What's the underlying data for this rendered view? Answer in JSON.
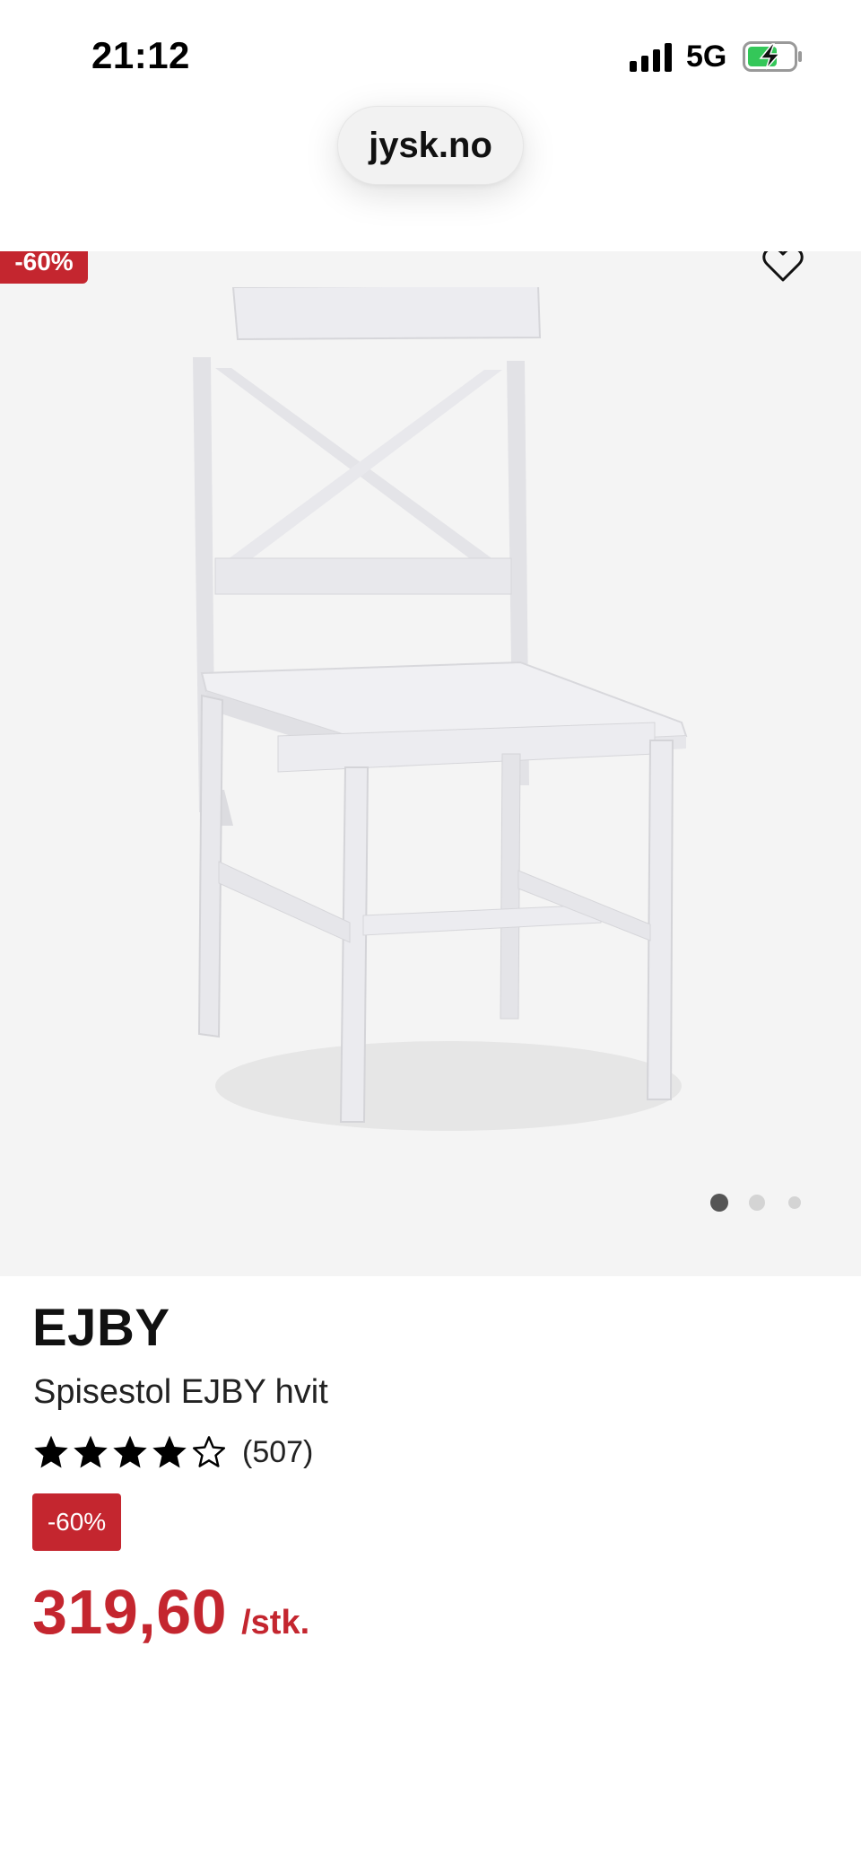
{
  "status_bar": {
    "time": "21:12",
    "network": "5G"
  },
  "browser": {
    "url": "jysk.no"
  },
  "gallery": {
    "discount_label": "-60%",
    "slide_count": 3,
    "active_slide": 1
  },
  "product": {
    "brand": "EJBY",
    "name": "Spisestol EJBY hvit",
    "rating": 4,
    "rating_max": 5,
    "review_count": "(507)",
    "discount_badge": "-60%",
    "price": "319,60",
    "unit": "/stk."
  },
  "colors": {
    "accent": "#c4262f",
    "image_bg": "#f4f4f4"
  }
}
